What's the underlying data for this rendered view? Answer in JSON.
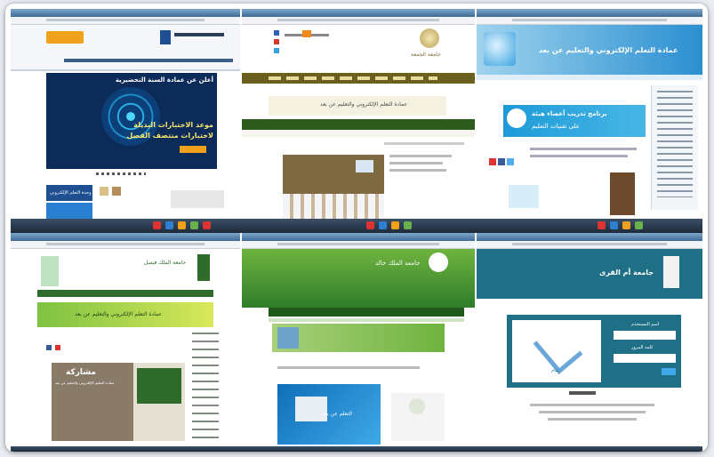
{
  "tiles": {
    "t1": {
      "banner_line1": "أعلن عن عمادة السنة التحضيرية",
      "banner_line2": "موعد الاختبارات البديلة",
      "banner_line3": "لاختبارات منتصف الفصل",
      "side_label": "وحدة التعلم الإلكتروني"
    },
    "t2": {
      "logo_text": "جامعة الجمعة",
      "welcome": "عمادة التعلم الإلكتروني والتعليم عن بعد"
    },
    "t3": {
      "header": "عمادة التعلم الإلكتروني والتعليم عن بعد",
      "promo_line1": "برنامج تدريب أعضاء هيئة",
      "promo_line2": "على تقنيات التعليم"
    },
    "t4": {
      "header_ar": "جامعة الملك فيصل",
      "banner": "عمادة التعلم الإلكتروني والتعليم عن بعد",
      "news_title": "مشاركة",
      "news_sub": "عمادة التعليم الإلكتروني والتعليم عن بعد"
    },
    "t5": {
      "header_ar": "جامعة الملك خالد",
      "promo": "التعلم عن بعد"
    },
    "t6": {
      "header": "جامعة أم القرى",
      "login_caption": "تمام",
      "field1": "اسم المستخدم",
      "field2": "كلمة المرور"
    }
  },
  "colors": {
    "taskbar": "#1d2a3a",
    "green_dark": "#2f6b2a",
    "green_light": "#6fb33f",
    "blue_header": "#1a8fd1",
    "teal_header": "#1f6f86"
  }
}
